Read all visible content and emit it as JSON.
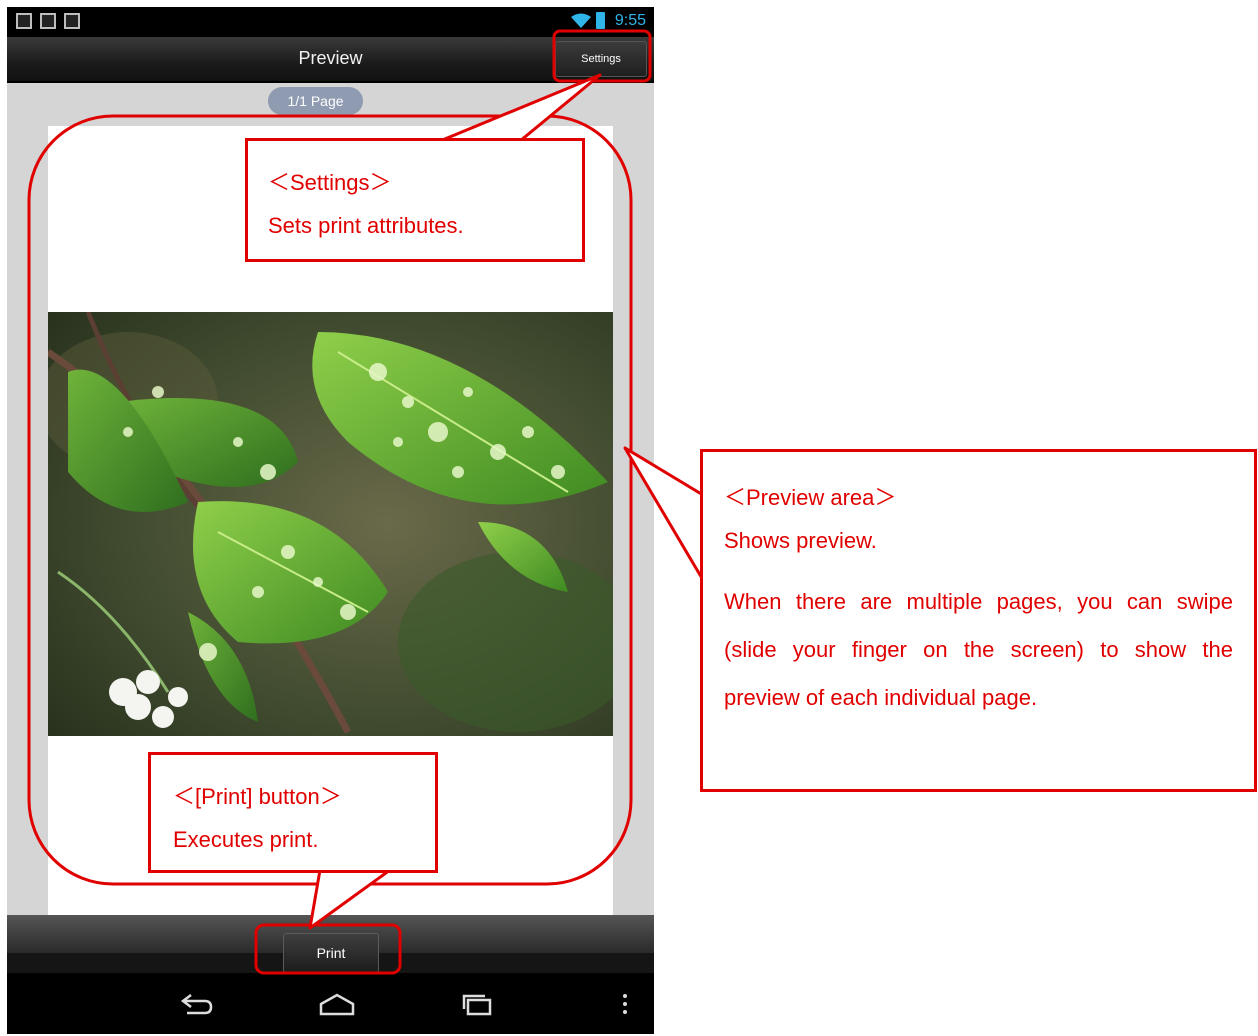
{
  "status_bar": {
    "time": "9:55"
  },
  "action_bar": {
    "title": "Preview",
    "settings_label": "Settings"
  },
  "preview": {
    "page_indicator": "1/1 Page"
  },
  "bottom": {
    "print_label": "Print"
  },
  "callouts": {
    "settings": {
      "title": "＜Settings＞",
      "desc": "Sets print attributes."
    },
    "preview_area": {
      "title": "＜Preview area＞",
      "line1": "Shows preview.",
      "desc": "When there are multiple pages, you can swipe (slide your finger on the screen) to show the preview of each individual page."
    },
    "print": {
      "title": "＜[Print] button＞",
      "desc": "Executes print."
    }
  },
  "colors": {
    "annotation": "#e00000",
    "status_accent": "#2fb5e8"
  }
}
